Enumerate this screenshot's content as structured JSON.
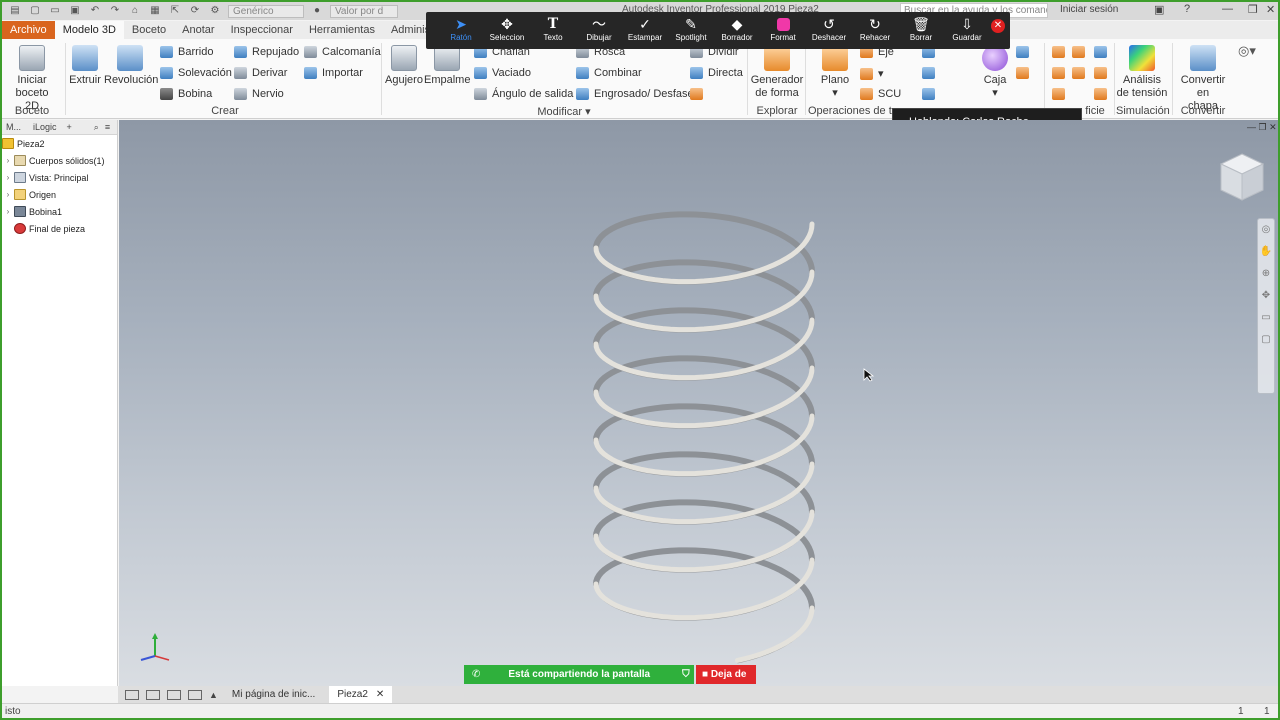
{
  "qat": {
    "style_combo": "Genérico",
    "value_combo": "Valor por d",
    "app_title": "Autodesk Inventor Professional 2019",
    "doc_title": "Pieza2",
    "search_placeholder": "Buscar en la ayuda y los comand",
    "sign_in": "Iniciar sesión"
  },
  "tabs": [
    "Archivo",
    "Modelo 3D",
    "Boceto",
    "Anotar",
    "Inspeccionar",
    "Herramientas",
    "Administrar"
  ],
  "ribbon": {
    "boceto": {
      "start_sketch_l1": "Iniciar",
      "start_sketch_l2": "boceto 2D",
      "label": "Boceto"
    },
    "crear": {
      "extruir": "Extruir",
      "revolucion": "Revolución",
      "barrido": "Barrido",
      "solevacion": "Solevación",
      "bobina": "Bobina",
      "repujado": "Repujado",
      "derivar": "Derivar",
      "nervio": "Nervio",
      "calcomania": "Calcomanía",
      "importar": "Importar",
      "label": "Crear"
    },
    "modificar": {
      "agujero": "Agujero",
      "empalme": "Empalme",
      "chaflan": "Chaflán",
      "vaciado": "Vaciado",
      "angulo": "Ángulo de salida",
      "rosca": "Rosca",
      "combinar": "Combinar",
      "engrosado": "Engrosado/ Desfase",
      "dividir": "Dividir",
      "directa": "Directa",
      "label": "Modificar"
    },
    "explorar": {
      "gen_l1": "Generador",
      "gen_l2": "de forma",
      "label": "Explorar"
    },
    "operaciones": {
      "plano": "Plano",
      "eje": "Eje",
      "scu": "SCU",
      "label": "Operaciones de tra"
    },
    "caja": "Caja",
    "superficie_label": "ficie",
    "simulacion": {
      "a_l1": "Análisis",
      "a_l2": "de tensión",
      "label": "Simulación"
    },
    "convertir": {
      "c_l1": "Convertir en",
      "c_l2": "chapa",
      "label": "Convertir"
    }
  },
  "zoom_toolbar": {
    "items": [
      "Ratón",
      "Seleccion",
      "Texto",
      "Dibujar",
      "Estampar",
      "Spotlight",
      "Borrador",
      "Format",
      "Deshacer",
      "Rehacer",
      "Borrar",
      "Guardar"
    ],
    "active": "Ratón"
  },
  "speaking": "Hablando: Carlos Roche",
  "browser": {
    "tab1": "M...",
    "tab2": "iLogic",
    "tree": [
      "Pieza2",
      "Cuerpos sólidos(1)",
      "Vista: Principal",
      "Origen",
      "Bobina1",
      "Final de pieza"
    ]
  },
  "share": {
    "sharing_text": "Está compartiendo la pantalla",
    "stop_text": "Deja de"
  },
  "doc_tabs": {
    "home": "Mi página de inic...",
    "doc": "Pieza2"
  },
  "status": {
    "left": "isto",
    "n1": "1",
    "n2": "1"
  },
  "colors": {
    "archivo_tab": "#d9651e",
    "share_green": "#2fb03c",
    "share_red": "#e0282b",
    "zoom_active": "#3d8ff5"
  }
}
